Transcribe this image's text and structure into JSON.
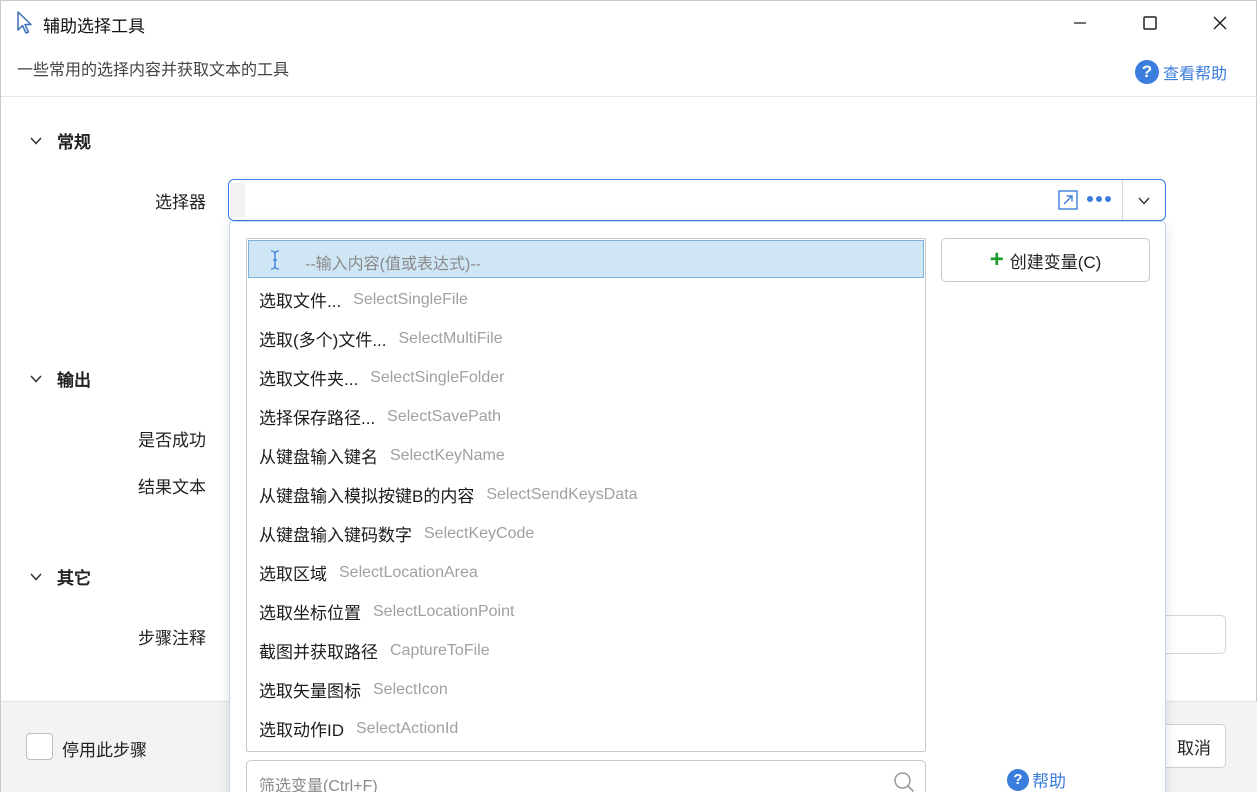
{
  "window": {
    "title": "辅助选择工具",
    "subtitle": "一些常用的选择内容并获取文本的工具",
    "help_label": "查看帮助"
  },
  "sections": {
    "general": {
      "title": "常规",
      "selector_label": "选择器"
    },
    "output": {
      "title": "输出",
      "success_label": "是否成功",
      "result_label": "结果文本"
    },
    "other": {
      "title": "其它",
      "note_label": "步骤注释"
    }
  },
  "footer": {
    "disable_label": "停用此步骤",
    "cancel_label": "取消"
  },
  "dropdown": {
    "input_placeholder": "--输入内容(值或表达式)--",
    "items": [
      {
        "label": "选取文件...",
        "code": "SelectSingleFile"
      },
      {
        "label": "选取(多个)文件...",
        "code": "SelectMultiFile"
      },
      {
        "label": "选取文件夹...",
        "code": "SelectSingleFolder"
      },
      {
        "label": "选择保存路径...",
        "code": "SelectSavePath"
      },
      {
        "label": "从键盘输入键名",
        "code": "SelectKeyName"
      },
      {
        "label": "从键盘输入模拟按键B的内容",
        "code": "SelectSendKeysData"
      },
      {
        "label": "从键盘输入键码数字",
        "code": "SelectKeyCode"
      },
      {
        "label": "选取区域",
        "code": "SelectLocationArea"
      },
      {
        "label": "选取坐标位置",
        "code": "SelectLocationPoint"
      },
      {
        "label": "截图并获取路径",
        "code": "CaptureToFile"
      },
      {
        "label": "选取矢量图标",
        "code": "SelectIcon"
      },
      {
        "label": "选取动作ID",
        "code": "SelectActionId"
      }
    ],
    "create_variable_label": "创建变量(C)",
    "filter_placeholder": "筛选变量(Ctrl+F)",
    "help_label": "帮助"
  },
  "colors": {
    "accent": "#3b7ddd",
    "highlight_bg": "#cfe6f5",
    "plus_green": "#1a9b2a"
  },
  "icons": [
    "cursor-icon",
    "minimize-icon",
    "maximize-icon",
    "close-icon",
    "help-icon",
    "chevron-down-icon",
    "open-external-icon",
    "more-icon",
    "text-cursor-icon",
    "plus-icon",
    "search-icon"
  ]
}
